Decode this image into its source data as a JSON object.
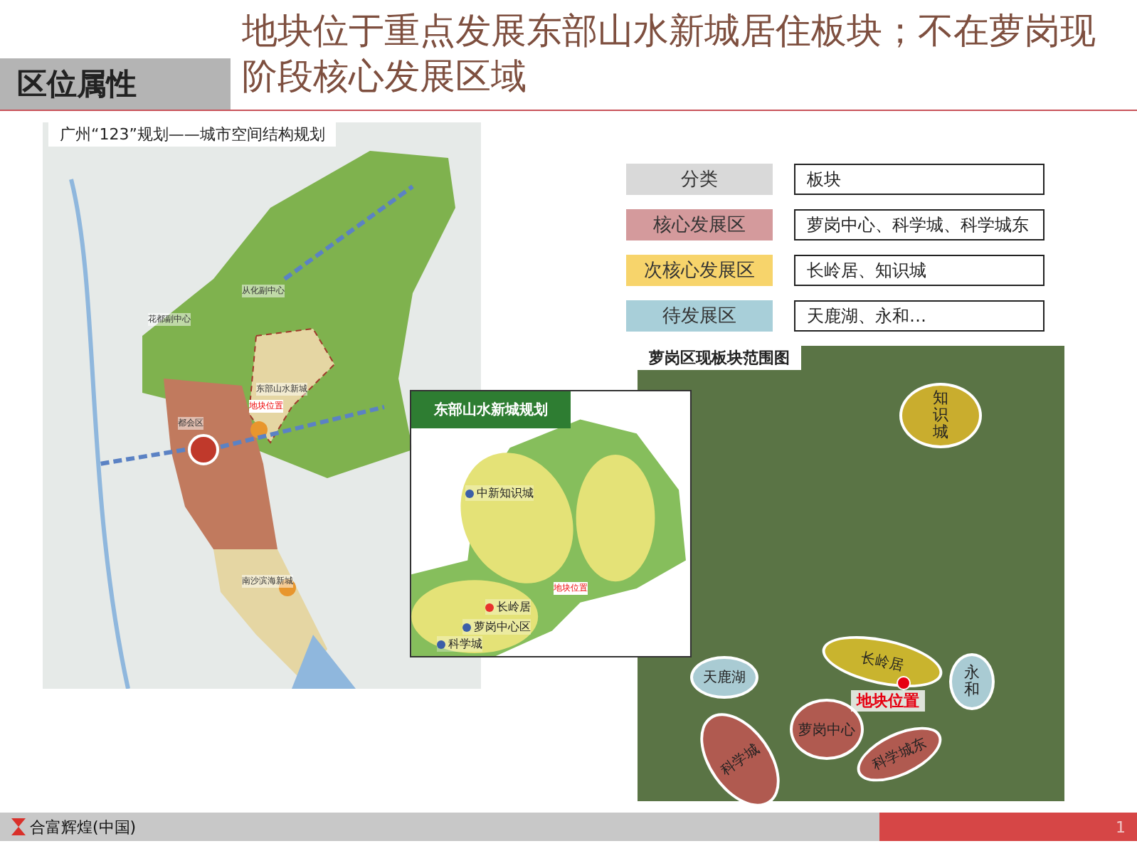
{
  "section_tab": "区位属性",
  "title": "地块位于重点发展东部山水新城居住板块；不在萝岗现阶段核心发展区域",
  "city_map": {
    "caption": "广州“123”规划——城市空间结构规划",
    "labels": [
      {
        "text": "从化副中心",
        "kind": "zone"
      },
      {
        "text": "花都副中心",
        "kind": "zone"
      },
      {
        "text": "东部山水新城",
        "kind": "zone"
      },
      {
        "text": "都会区",
        "kind": "zone"
      },
      {
        "text": "地块位置",
        "kind": "site"
      },
      {
        "text": "南沙滨海新城",
        "kind": "zone"
      }
    ]
  },
  "inset_map": {
    "title": "东部山水新城规划",
    "labels": [
      {
        "text": "中新知识城",
        "kind": "place",
        "color": "#3c5fa8"
      },
      {
        "text": "长岭居",
        "kind": "place",
        "color": "#e8322d"
      },
      {
        "text": "萝岗中心区",
        "kind": "place",
        "color": "#3c5fa8"
      },
      {
        "text": "科学城",
        "kind": "place",
        "color": "#3c5fa8"
      },
      {
        "text": "地块位置",
        "kind": "site"
      }
    ]
  },
  "legend": [
    {
      "category": "分类",
      "value": "板块",
      "color": "#d9d9d9"
    },
    {
      "category": "核心发展区",
      "value": "萝岗中心、科学城、科学城东",
      "color": "#d49a9c"
    },
    {
      "category": "次核心发展区",
      "value": "长岭居、知识城",
      "color": "#f7d46b"
    },
    {
      "category": "待发展区",
      "value": "天鹿湖、永和…",
      "color": "#a8cfd9"
    }
  ],
  "district_map": {
    "caption": "萝岗区现板块范围图",
    "zones": [
      {
        "text": "知识城",
        "color": "#c9ad2e"
      },
      {
        "text": "长岭居",
        "color": "#c9b42e"
      },
      {
        "text": "永和",
        "color": "#a9cbd3"
      },
      {
        "text": "天鹿湖",
        "color": "#a9cbd3"
      },
      {
        "text": "科学城",
        "color": "#b05a50"
      },
      {
        "text": "萝岗中心",
        "color": "#b05a50"
      },
      {
        "text": "科学城东",
        "color": "#b05a50"
      }
    ],
    "site_label": "地块位置"
  },
  "footer": {
    "logo_text": "合富辉煌(中国)",
    "page_number": "1"
  }
}
